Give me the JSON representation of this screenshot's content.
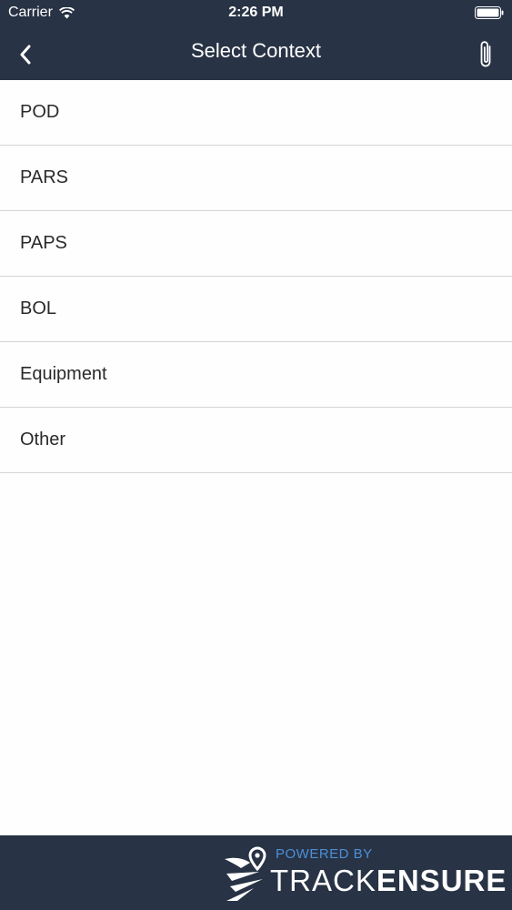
{
  "status_bar": {
    "carrier": "Carrier",
    "time": "2:26 PM"
  },
  "nav": {
    "title": "Select Context",
    "back_icon": "chevron-left-icon",
    "attach_icon": "paperclip-icon"
  },
  "contexts": [
    {
      "label": "POD"
    },
    {
      "label": "PARS"
    },
    {
      "label": "PAPS"
    },
    {
      "label": "BOL"
    },
    {
      "label": "Equipment"
    },
    {
      "label": "Other"
    }
  ],
  "footer": {
    "powered_by": "POWERED BY",
    "brand_light": "TRACK",
    "brand_bold": "ENSURE"
  },
  "colors": {
    "header": "#283345",
    "footer": "#283345",
    "accent": "#4c8fd6",
    "separator": "#d4d4d8"
  }
}
